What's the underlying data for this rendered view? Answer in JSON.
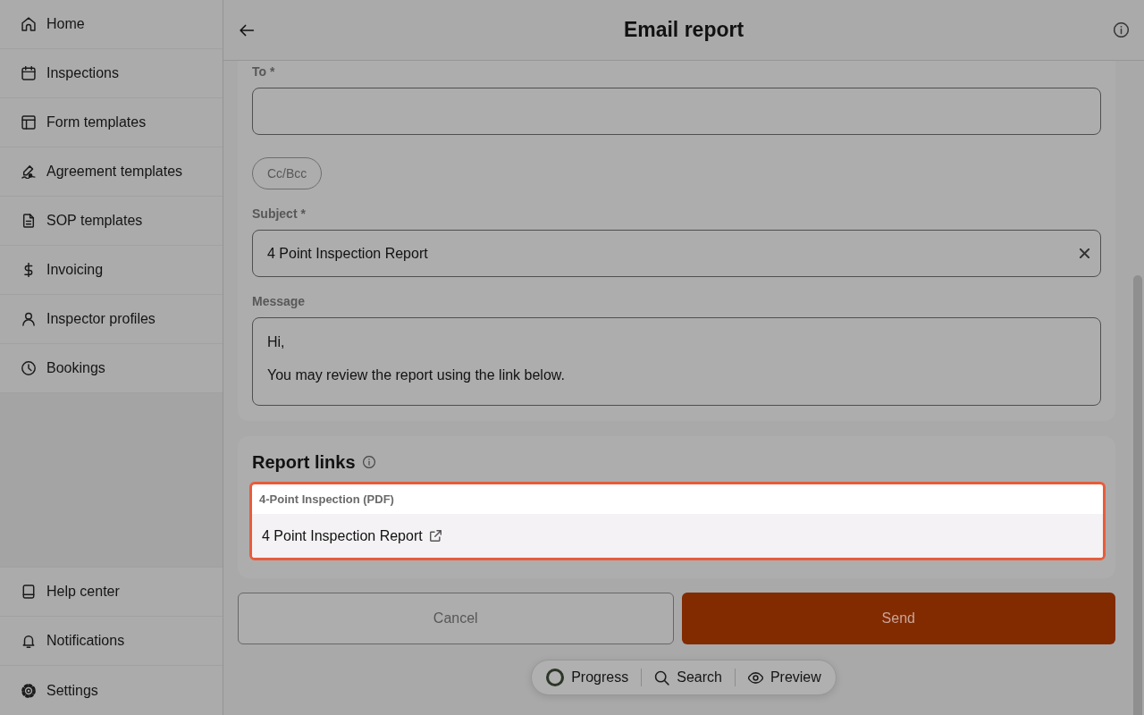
{
  "sidebar": {
    "items": [
      {
        "label": "Home"
      },
      {
        "label": "Inspections"
      },
      {
        "label": "Form templates"
      },
      {
        "label": "Agreement templates"
      },
      {
        "label": "SOP templates"
      },
      {
        "label": "Invoicing"
      },
      {
        "label": "Inspector profiles"
      },
      {
        "label": "Bookings"
      }
    ],
    "footer_items": [
      {
        "label": "Help center"
      },
      {
        "label": "Notifications"
      },
      {
        "label": "Settings"
      }
    ]
  },
  "header": {
    "title": "Email report"
  },
  "email_form": {
    "fields": [
      {
        "kind": "input",
        "label": "To *"
      },
      {
        "kind": "chip",
        "label": "Cc/Bcc"
      },
      {
        "kind": "input",
        "label": "Subject *",
        "value": "4 Point Inspection Report"
      },
      {
        "kind": "textarea",
        "label": "Message",
        "paragraphs": [
          "Hi,",
          "You may review the report using the link below."
        ]
      }
    ]
  },
  "report_links": {
    "title": "Report links",
    "groups": [
      {
        "label": "4-Point Inspection (PDF)",
        "highlighted": true,
        "links": [
          {
            "label": "4 Point Inspection Report"
          }
        ]
      }
    ]
  },
  "actions": [
    {
      "kind": "secondary",
      "label": "Cancel"
    },
    {
      "kind": "primary",
      "label": "Send"
    }
  ],
  "toolbar": {
    "items": [
      {
        "label": "Progress"
      },
      {
        "label": "Search"
      },
      {
        "label": "Preview"
      }
    ]
  }
}
